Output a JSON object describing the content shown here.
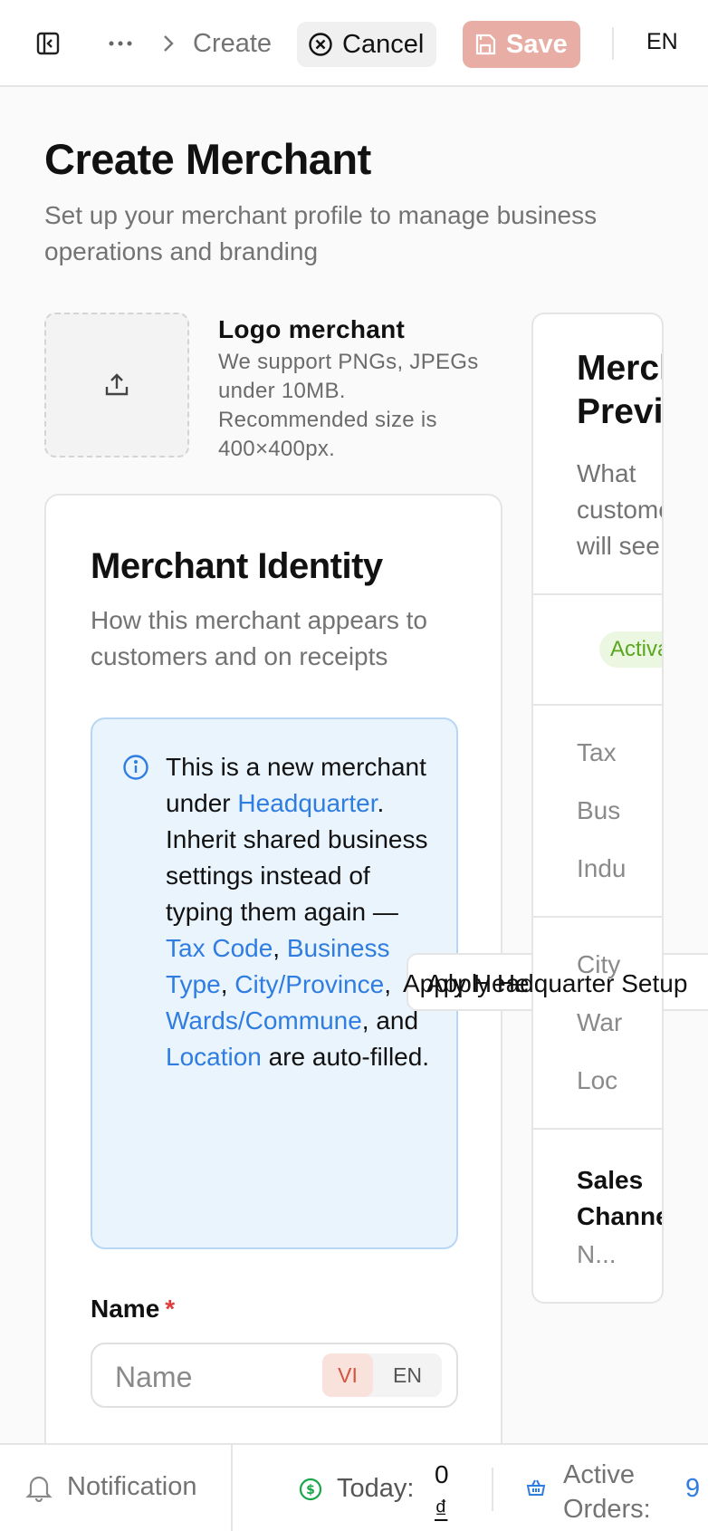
{
  "topbar": {
    "breadcrumb_current": "Create",
    "cancel_label": "Cancel",
    "save_label": "Save",
    "language": "EN"
  },
  "header": {
    "title": "Create Merchant",
    "subtitle": "Set up your merchant profile to manage business operations and branding"
  },
  "logo": {
    "title": "Logo merchant",
    "description": "We support PNGs, JPEGs under 10MB. Recommended size is 400×400px."
  },
  "identity": {
    "title": "Merchant Identity",
    "subtitle": "How this merchant appears to customers and on receipts",
    "info": {
      "t1": "This is a new merchant under ",
      "link_hq": "Headquarter",
      "t2": ". Inherit shared business settings instead of typing them again — ",
      "link_tax": "Tax Code",
      "link_business": "Business Type",
      "link_city": "City/Province",
      "link_wards": "Wards/Commune",
      "t3": ", and ",
      "link_location": "Location",
      "t4": " are auto-filled.",
      "comma": ","
    },
    "apply_button_label": "Apply Headquarter Setup",
    "name_label": "Name",
    "name_required": "*",
    "name_placeholder": "Name",
    "lang_vi": "VI",
    "lang_en": "EN"
  },
  "preview": {
    "title": "Merchant Preview",
    "subtitle": "What customers will see",
    "status_badge": "Activated",
    "rows_group1": [
      "Tax",
      "Bus",
      "Indu"
    ],
    "rows_group2": [
      "City",
      "War",
      "Loc"
    ],
    "sales_title": "Sales Channel",
    "sales_value": "N..."
  },
  "bottombar": {
    "notification_label": "Notification",
    "today_label": "Today:",
    "today_value": "0",
    "today_currency": "₫",
    "orders_label": "Active Orders:",
    "orders_value": "9"
  },
  "colors": {
    "accent_blue": "#2f7de1",
    "save_disabled": "#e8aea5",
    "badge_green": "#5aa61e",
    "required_red": "#e23b3b"
  }
}
